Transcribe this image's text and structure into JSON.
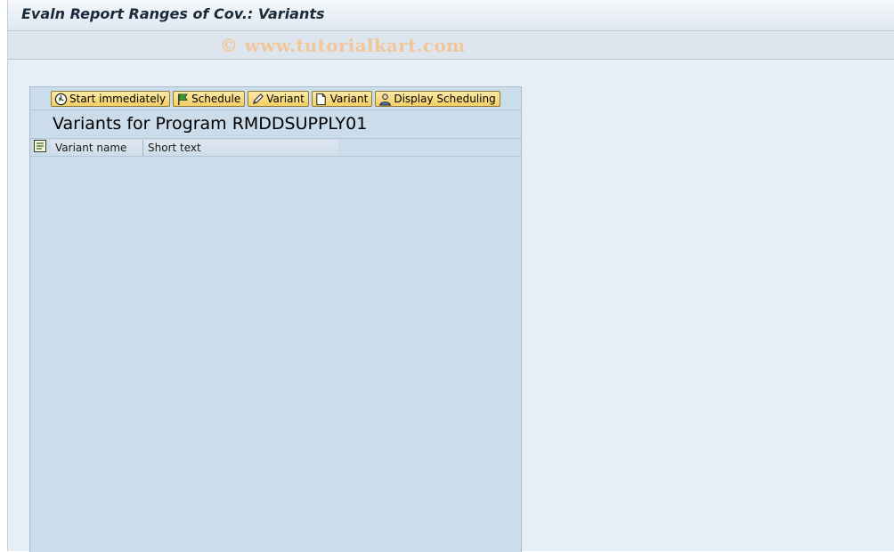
{
  "window": {
    "title": "Evaln Report Ranges of Cov.: Variants",
    "watermark": "© www.tutorialkart.com"
  },
  "toolbar": {
    "buttons": [
      {
        "label": "Start immediately",
        "icon": "clock-execute-icon"
      },
      {
        "label": "Schedule",
        "icon": "flag-icon"
      },
      {
        "label": "Variant",
        "icon": "pencil-icon"
      },
      {
        "label": "Variant",
        "icon": "new-document-icon"
      },
      {
        "label": "Display Scheduling",
        "icon": "person-schedule-icon"
      }
    ]
  },
  "list": {
    "title": "Variants for Program RMDDSUPPLY01",
    "columns": [
      "Variant name",
      "Short text"
    ],
    "rows": []
  }
}
